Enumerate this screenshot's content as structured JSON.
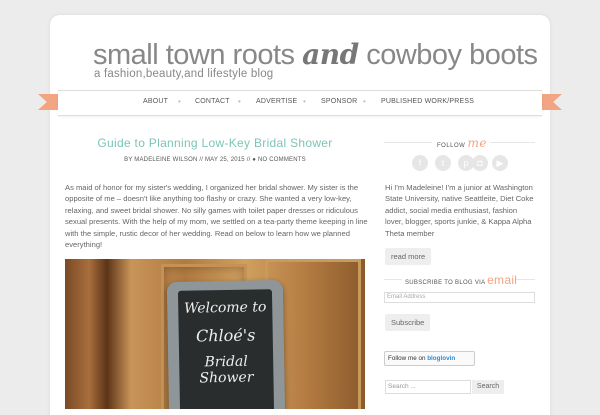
{
  "header": {
    "title_part1": "small town roots ",
    "title_and": "and",
    "title_part2": " cowboy boots",
    "tagline": "a fashion,beauty,and lifestyle blog"
  },
  "nav": {
    "items": [
      "ABOUT",
      "CONTACT",
      "ADVERTISE",
      "SPONSOR",
      "PUBLISHED WORK/PRESS"
    ]
  },
  "post": {
    "title": "Guide to Planning Low-Key Bridal Shower",
    "byline": "BY MADELEINE WILSON // MAY 25, 2015 // ● NO COMMENTS",
    "body": "As maid of honor for my sister's wedding, I organized her bridal shower. My sister is the opposite of me – doesn't like anything too flashy or crazy. She wanted a very low-key, relaxing, and sweet bridal shower. No silly games with toilet paper dresses or ridiculous sexual presents. With the help of my mom, we settled on a tea-party theme keeping in line with the simple, rustic decor of her wedding. Read on below to learn how we planned everything!",
    "image_text": [
      "Welcome to",
      "Chloé's",
      "Bridal Shower"
    ]
  },
  "sidebar": {
    "follow_label": "FOLLOW",
    "follow_me": "me",
    "social_icons": [
      "facebook-icon",
      "twitter-icon",
      "pinterest-icon",
      "instagram-icon",
      "youtube-icon"
    ],
    "about_text": "Hi I'm Madeleine! I'm a junior at Washington State University, native Seattleite, Diet Coke addict, social media enthusiast, fashion lover, blogger, sports junkie, & Kappa Alpha Theta member",
    "read_more": "read more",
    "subscribe_label": "SUBSCRIBE TO BLOG VIA",
    "subscribe_em": "email",
    "email_placeholder": "Email Address",
    "subscribe_button": "Subscribe",
    "bloglovin_prefix": "Follow me on",
    "bloglovin_brand": "bloglovin",
    "search_placeholder": "Search ...",
    "search_button": "Search"
  },
  "colors": {
    "accent": "#f3a483",
    "title_teal": "#7cc5b7"
  }
}
